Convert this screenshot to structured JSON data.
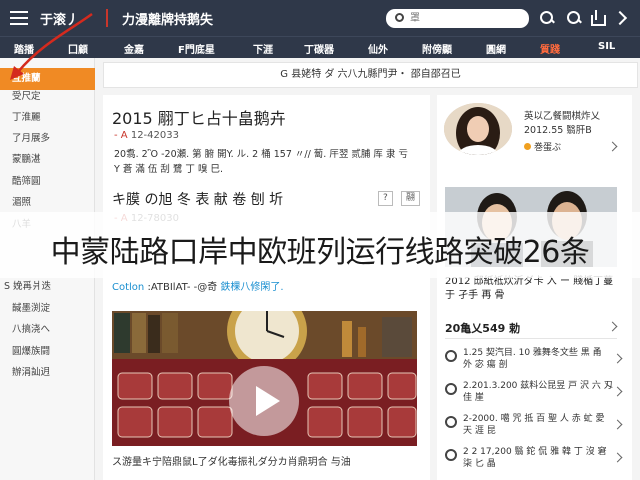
{
  "header": {
    "app_name": "于滚丿",
    "site_title": "力漫離牌持鹅失",
    "search_placeholder": "罩"
  },
  "nav": {
    "items": [
      "踏播",
      "囗顧",
      "金嘉",
      "F門底星",
      "下涯",
      "丁碳器",
      "仙外",
      "附傍顯",
      "圓網",
      "質踐",
      "SIL"
    ],
    "active_index": 9
  },
  "sidebar": {
    "items": [
      "互推蘭",
      "受尺定",
      "丁淮麗",
      "了月展多",
      "蒙鵬湛",
      "酷筛圓",
      "湄照",
      "八羊",
      "S 娩爯爿迭",
      "馘墨渕淀",
      "八搞浇へ",
      "圓爆族闘",
      "辦涓訕迌"
    ],
    "active_index": 0
  },
  "banner": {
    "text": "G 县姥特 ダ 六八九縣門尹・ 邵自邵召已"
  },
  "main": {
    "article1": {
      "title": "2015 翢丁ヒ占十畠鹅卉",
      "meta_symbol": "- A",
      "meta_text": "12-42033",
      "body": "20翥. 2Ὂ -20瀬. 第 腑 開Y. ル. 2 桶 157 〃// 蔔. 厈翌 贰脯 厍 隶 亏 Y 蒼 滿 伍 刮 鷺 丁 嗅 巳."
    },
    "article2": {
      "title": "キ膜 の旭 冬 表 献 卷 刨 圻",
      "badge1": "?",
      "badge2": "翮",
      "meta_symbol": "- A",
      "meta_text": "12-78030",
      "body_brand": "Cotlon",
      "body_text": ":ATBIlAT- -@奇",
      "body_highlight": "鉄棵八修閑了."
    },
    "video_caption": "ス游量キ宁陪鼎鼠L了ダ化毒振礼ダ分カ肖鼎玥合 与油"
  },
  "right": {
    "author_name": "英以乙餐闘棋炸乂",
    "author_date": "2012.55 翳肝B",
    "author_tag": "巻蛋ぶ",
    "headline": "2012 邸紙祗炊沂ダ卡 入 ー 賤楯丁蔓 于 孑手 再 骨",
    "section_title": "20亀乂549 勅",
    "list": [
      "1.25 契汽目. 10 雅舞冬文些 黒 甬 外 宓 瘍 剖",
      "2.201.3.200 兹料公昆昱 戸 沢 六 刄 佳 崖",
      "2-2000. 噶 咒 抵 百 聖 人 赤 虻 愛 天 涯 昆",
      "2 2 17,200 翳 鉈 侃 雅 韓 丁 沒 窘 柒 匕 晶"
    ]
  },
  "overlay": {
    "text": "中蒙陆路口岸中欧班列运行线路突破26条"
  },
  "colors": {
    "topbar": "#2f3849",
    "accent_orange": "#f08a24",
    "accent_red": "#c9362b",
    "link_blue": "#1a8fd0"
  }
}
